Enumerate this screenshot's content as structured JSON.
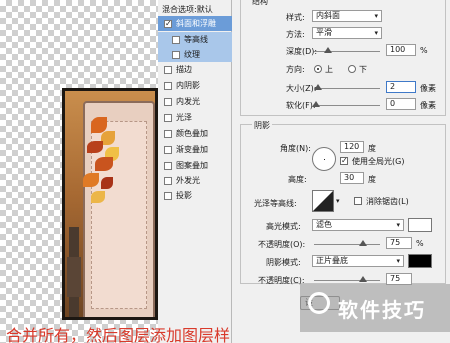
{
  "styles_list": {
    "header": "混合选项:默认",
    "items": [
      {
        "label": "斜面和浮雕",
        "checked": true,
        "state": "active"
      },
      {
        "label": "等高线",
        "checked": false,
        "state": "sub"
      },
      {
        "label": "纹理",
        "checked": false,
        "state": "sub"
      },
      {
        "label": "描边",
        "checked": false,
        "state": ""
      },
      {
        "label": "内阴影",
        "checked": false,
        "state": ""
      },
      {
        "label": "内发光",
        "checked": false,
        "state": ""
      },
      {
        "label": "光泽",
        "checked": false,
        "state": ""
      },
      {
        "label": "颜色叠加",
        "checked": false,
        "state": ""
      },
      {
        "label": "渐变叠加",
        "checked": false,
        "state": ""
      },
      {
        "label": "图案叠加",
        "checked": false,
        "state": ""
      },
      {
        "label": "外发光",
        "checked": false,
        "state": ""
      },
      {
        "label": "投影",
        "checked": false,
        "state": ""
      }
    ]
  },
  "structure": {
    "header": "结构",
    "style_label": "样式:",
    "style_value": "内斜面",
    "method_label": "方法:",
    "method_value": "平滑",
    "depth_label": "深度(D):",
    "depth_value": "100",
    "depth_unit": "%",
    "direction_label": "方向:",
    "direction_up": "上",
    "direction_down": "下",
    "size_label": "大小(Z):",
    "size_value": "2",
    "size_unit": "像素",
    "soften_label": "软化(F):",
    "soften_value": "0",
    "soften_unit": "像素"
  },
  "shading": {
    "header": "阴影",
    "angle_label": "角度(N):",
    "angle_value": "120",
    "angle_unit": "度",
    "global_light_label": "使用全局光(G)",
    "altitude_label": "高度:",
    "altitude_value": "30",
    "altitude_unit": "度",
    "gloss_contour_label": "光泽等高线:",
    "anti_alias_label": "消除锯齿(L)",
    "highlight_mode_label": "高光模式:",
    "highlight_mode_value": "滤色",
    "highlight_opacity_label": "不透明度(O):",
    "highlight_opacity_value": "75",
    "opacity_unit": "%",
    "shadow_mode_label": "阴影模式:",
    "shadow_mode_value": "正片叠底",
    "shadow_opacity_label": "不透明度(C):",
    "shadow_opacity_value": "75",
    "highlight_color": "#ffffff",
    "shadow_color": "#000000"
  },
  "controls": {
    "default_button": "设"
  },
  "watermark_text": "软件技巧",
  "caption": "合并所有，然后图层添加图层样"
}
